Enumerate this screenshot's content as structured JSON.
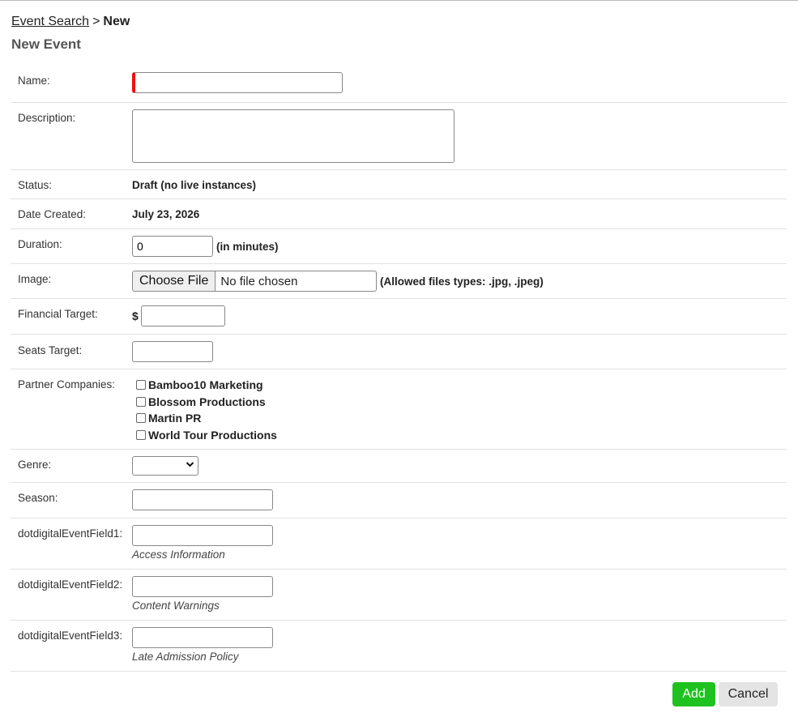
{
  "breadcrumb": {
    "link": "Event Search",
    "separator": ">",
    "current": "New"
  },
  "page_title": "New Event",
  "form": {
    "name_label": "Name:",
    "name_value": "",
    "description_label": "Description:",
    "status_label": "Status:",
    "status_value": "Draft (no live instances)",
    "date_label": "Date Created:",
    "date_value": "July 23, 2026",
    "duration_label": "Duration:",
    "duration_value": "0",
    "duration_unit": "(in minutes)",
    "image_label": "Image:",
    "image_button": "Choose File",
    "image_file_status": "No file chosen",
    "image_note": "(Allowed files types: .jpg, .jpeg)",
    "financial_label": "Financial Target:",
    "currency_symbol": "$",
    "seats_label": "Seats Target:",
    "partners_label": "Partner Companies:",
    "partners": [
      "Bamboo10 Marketing",
      "Blossom Productions",
      "Martin PR",
      "World Tour Productions"
    ],
    "genre_label": "Genre:",
    "genre_value": "",
    "season_label": "Season:",
    "field1_label": "dotdigitalEventField1:",
    "field1_hint": "Access Information",
    "field2_label": "dotdigitalEventField2:",
    "field2_hint": "Content Warnings",
    "field3_label": "dotdigitalEventField3:",
    "field3_hint": "Late Admission Policy"
  },
  "actions": {
    "add_label": "Add",
    "cancel_label": "Cancel"
  },
  "colors": {
    "add_button": "#1ec21e",
    "required_marker": "#e11111",
    "cancel_button": "#e4e4e4"
  }
}
